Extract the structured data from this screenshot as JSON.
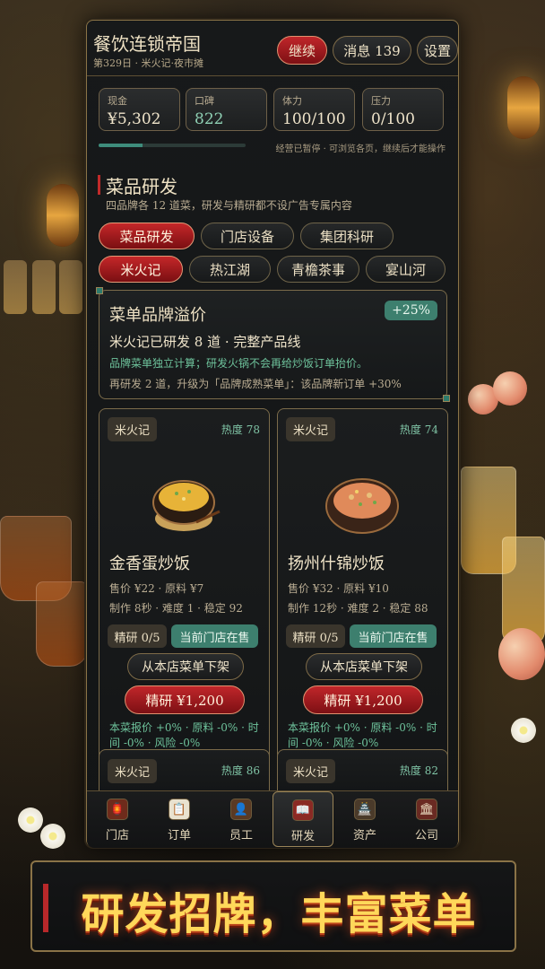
{
  "header": {
    "title": "餐饮连锁帝国",
    "subtitle": "第329日 · 米火记·夜市摊",
    "continue_label": "继续",
    "messages_label": "消息 139",
    "settings_label": "设置"
  },
  "stats": [
    {
      "label": "现金",
      "value": "¥5,302"
    },
    {
      "label": "口碑",
      "value": "822"
    },
    {
      "label": "体力",
      "value": "100/100"
    },
    {
      "label": "压力",
      "value": "0/100"
    }
  ],
  "progress_fraction": 0.3,
  "paused_text": "经营已暂停 · 可浏览各页，继续后才能操作",
  "section": {
    "title": "菜品研发",
    "desc": "四品牌各 12 道菜，研发与精研都不设广告专属内容"
  },
  "tabs": [
    {
      "label": "菜品研发",
      "active": true
    },
    {
      "label": "门店设备",
      "active": false
    },
    {
      "label": "集团科研",
      "active": false
    }
  ],
  "brands": [
    {
      "label": "米火记",
      "active": true
    },
    {
      "label": "热江湖",
      "active": false
    },
    {
      "label": "青檐茶事",
      "active": false
    },
    {
      "label": "宴山河",
      "active": false
    }
  ],
  "bonus": {
    "title": "菜单品牌溢价",
    "badge": "+25%",
    "line1": "米火记已研发 8 道 · 完整产品线",
    "line2": "品牌菜单独立计算；研发火锅不会再给炒饭订单抬价。",
    "line3": "再研发 2 道，升级为「品牌成熟菜单」：该品牌新订单 +30%"
  },
  "dishes": [
    {
      "brand": "米火记",
      "heat": "热度 78",
      "name": "金香蛋炒饭",
      "price": "售价 ¥22 · 原料 ¥7",
      "make": "制作 8秒 · 难度 1 · 稳定 92",
      "refine_count": "精研 0/5",
      "status": "当前门店在售",
      "remove_label": "从本店菜单下架",
      "refine_label": "精研 ¥1,200",
      "effect": "本菜报价 +0% · 原料 -0% · 时间 -0% · 风险 -0%",
      "food_color": "#e7b338"
    },
    {
      "brand": "米火记",
      "heat": "热度 74",
      "name": "扬州什锦炒饭",
      "price": "售价 ¥32 · 原料 ¥10",
      "make": "制作 12秒 · 难度 2 · 稳定 88",
      "refine_count": "精研 0/5",
      "status": "当前门店在售",
      "remove_label": "从本店菜单下架",
      "refine_label": "精研 ¥1,200",
      "effect": "本菜报价 +0% · 原料 -0% · 时间 -0% · 风险 -0%",
      "food_color": "#e08a5a"
    },
    {
      "brand": "米火记",
      "heat": "热度 86"
    },
    {
      "brand": "米火记",
      "heat": "热度 82"
    }
  ],
  "nav": [
    {
      "label": "门店",
      "icon": "store-icon",
      "active": false
    },
    {
      "label": "订单",
      "icon": "order-icon",
      "active": false
    },
    {
      "label": "员工",
      "icon": "staff-icon",
      "active": false
    },
    {
      "label": "研发",
      "icon": "book-icon",
      "active": true
    },
    {
      "label": "资产",
      "icon": "asset-icon",
      "active": false
    },
    {
      "label": "公司",
      "icon": "company-icon",
      "active": false
    }
  ],
  "banner": {
    "text": "研发招牌，丰富菜单"
  },
  "colors": {
    "accent_red": "#c0262a",
    "accent_green": "#3d7f6e",
    "gold_border": "#8a7347"
  }
}
